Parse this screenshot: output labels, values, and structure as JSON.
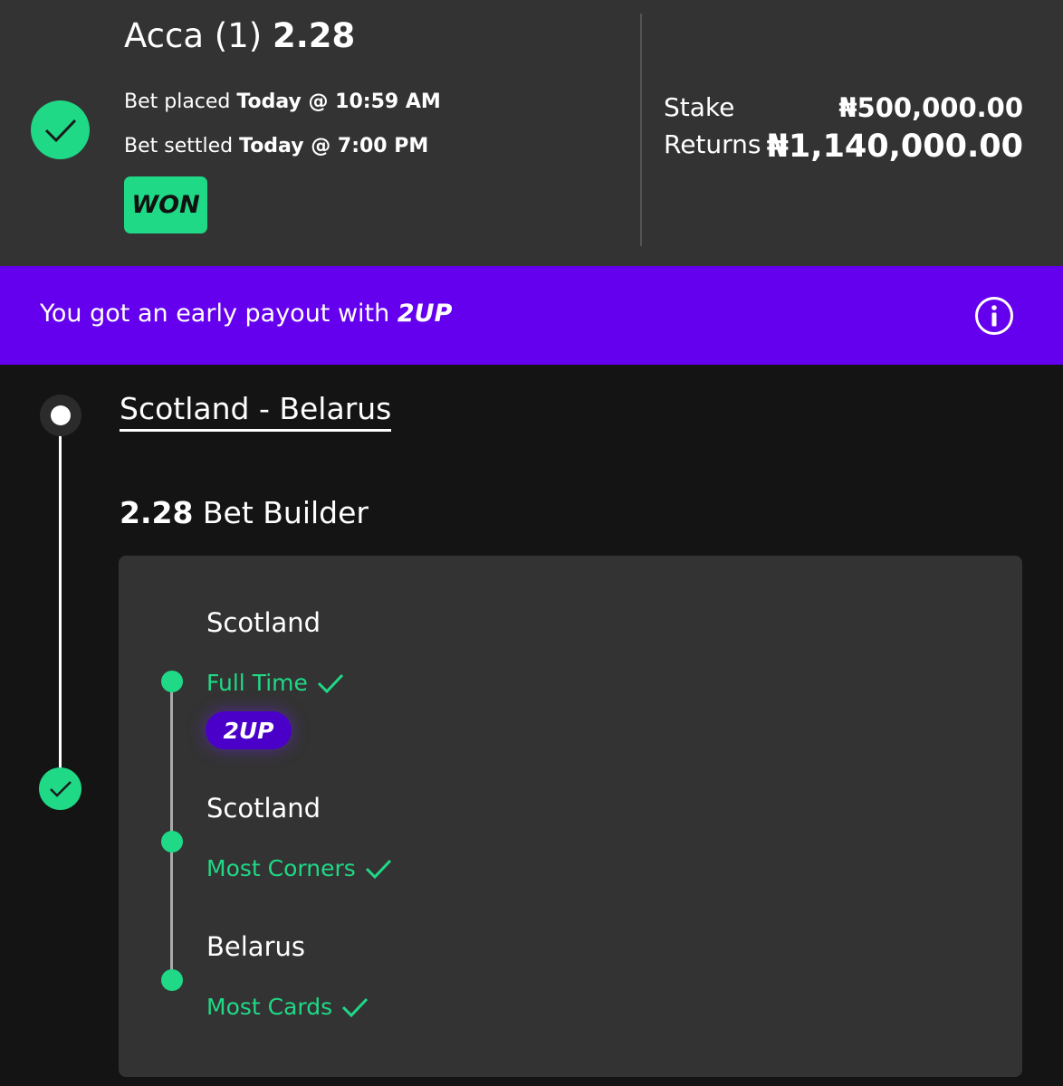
{
  "bet": {
    "title": "Acca (1)",
    "odds": "2.28",
    "placed_label": "Bet placed",
    "placed_value": "Today @ 10:59 AM",
    "settled_label": "Bet settled",
    "settled_value": "Today @ 7:00 PM",
    "status": "WON",
    "stake_label": "Stake",
    "stake_value": "₦500,000.00",
    "returns_label": "Returns",
    "returns_value": "₦1,140,000.00"
  },
  "promo": {
    "text": "You got an early payout with",
    "brand": "2UP",
    "icon": "info-icon"
  },
  "event": {
    "match": "Scotland - Belarus",
    "builder_odds": "2.28",
    "builder_label": "Bet Builder",
    "legs": [
      {
        "team": "Scotland",
        "market": "Full Time",
        "result": "check-icon",
        "tag": "2UP"
      },
      {
        "team": "Scotland",
        "market": "Most Corners",
        "result": "check-icon"
      },
      {
        "team": "Belarus",
        "market": "Most Cards",
        "result": "check-icon"
      }
    ]
  },
  "colors": {
    "accent_green": "#1fd986",
    "promo_purple": "#6500ee",
    "pill_purple": "#4a00c8",
    "header_bg": "#333333",
    "page_bg": "#141414"
  }
}
